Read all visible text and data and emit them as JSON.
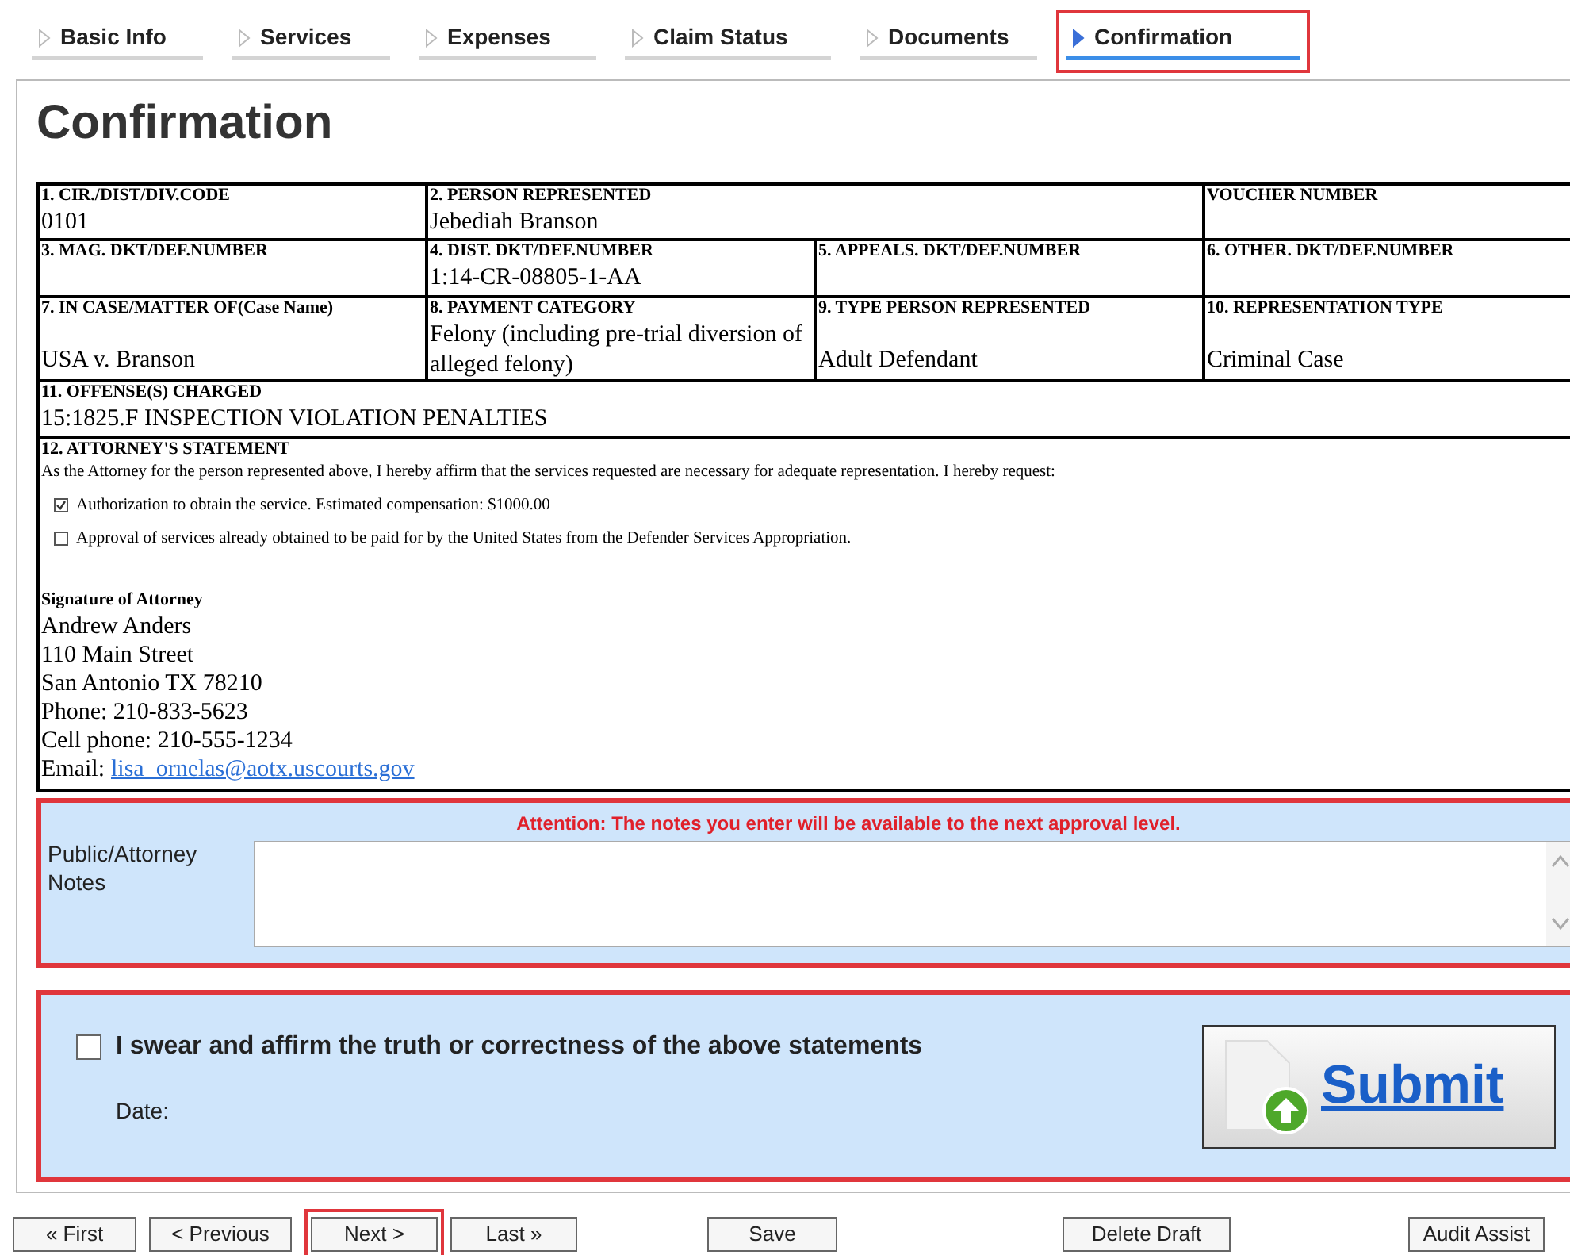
{
  "tabs": [
    {
      "label": "Basic Info",
      "selected": false,
      "highlighted": false
    },
    {
      "label": "Services",
      "selected": false,
      "highlighted": false
    },
    {
      "label": "Expenses",
      "selected": false,
      "highlighted": false
    },
    {
      "label": "Claim Status",
      "selected": false,
      "highlighted": false
    },
    {
      "label": "Documents",
      "selected": false,
      "highlighted": false
    },
    {
      "label": "Confirmation",
      "selected": true,
      "highlighted": true
    }
  ],
  "title": "Confirmation",
  "form": {
    "rows": [
      [
        {
          "label": "1. CIR./DIST/DIV.CODE",
          "value": "0101"
        },
        {
          "label": "2. PERSON REPRESENTED",
          "value": "Jebediah Branson"
        },
        {
          "kind": "merged"
        },
        {
          "label": "VOUCHER NUMBER"
        }
      ],
      [
        {
          "label": "3. MAG. DKT/DEF.NUMBER"
        },
        {
          "label": "4. DIST. DKT/DEF.NUMBER",
          "value": "1:14-CR-08805-1-AA"
        },
        {
          "label": "5. APPEALS. DKT/DEF.NUMBER"
        },
        {
          "label": "6. OTHER. DKT/DEF.NUMBER"
        }
      ],
      [
        {
          "label": "7. IN CASE/MATTER OF(Case Name)",
          "value": "USA v. Branson"
        },
        {
          "label": "8. PAYMENT CATEGORY",
          "value": "Felony (including pre-trial diversion of alleged felony)"
        },
        {
          "label": "9. TYPE PERSON REPRESENTED",
          "value": "Adult Defendant"
        },
        {
          "label": "10. REPRESENTATION TYPE",
          "value": "Criminal Case"
        }
      ],
      [
        {
          "label": "11. OFFENSE(S) CHARGED",
          "value": "15:1825.F INSPECTION VIOLATION PENALTIES"
        }
      ]
    ],
    "statement": {
      "label": "12. ATTORNEY'S STATEMENT",
      "text": "As the Attorney for the person represented above, I hereby affirm that the services requested are necessary for adequate representation. I hereby request:",
      "options": [
        {
          "text": "Authorization to obtain the service. Estimated compensation: $1000.00",
          "checked": true
        },
        {
          "text": "Approval of services already obtained to be paid for by the United States from the Defender Services Appropriation.",
          "checked": false
        }
      ],
      "signature_label": "Signature of Attorney",
      "signature_lines": [
        "Andrew Anders",
        "110 Main Street",
        "San Antonio TX 78210",
        "Phone: 210-833-5623",
        "Cell phone: 210-555-1234"
      ],
      "email_label": "Email:",
      "email": "lisa_ornelas@aotx.uscourts.gov"
    }
  },
  "notes": {
    "attention": "Attention: The notes you enter will be available to the next approval level.",
    "label": "Public/Attorney Notes",
    "highlighted": true
  },
  "affirm": {
    "label": "I swear and affirm the truth or correctness of the above statements",
    "checked": false,
    "date_label": "Date:",
    "submit": "Submit",
    "highlighted": true
  },
  "buttons": [
    {
      "label": "« First",
      "highlighted": false
    },
    {
      "label": "< Previous",
      "highlighted": false
    },
    {
      "label": "Next >",
      "highlighted": true
    },
    {
      "label": "Last »",
      "highlighted": false
    },
    {
      "label": "Save",
      "highlighted": false
    },
    {
      "label": "Delete Draft",
      "highlighted": false
    },
    {
      "label": "Audit Assist",
      "highlighted": false
    }
  ]
}
